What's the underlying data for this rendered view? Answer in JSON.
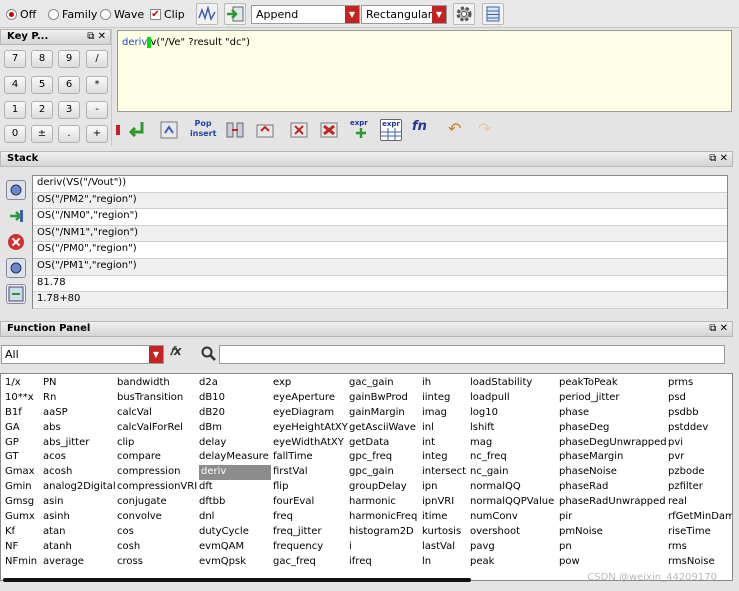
{
  "toolbar": {
    "radio_off": "Off",
    "radio_family": "Family",
    "radio_wave": "Wave",
    "check_clip": "Clip",
    "combo_mode": "Append",
    "combo_shape": "Rectangular"
  },
  "keypad": {
    "title": "Key P...",
    "keys": [
      "7",
      "8",
      "9",
      "/",
      "4",
      "5",
      "6",
      "*",
      "1",
      "2",
      "3",
      "-",
      "0",
      "±",
      ".",
      "+"
    ]
  },
  "editor": {
    "prefix": "deriv",
    "func": "v(\"/Ve\" ?result \"dc\")"
  },
  "editor_tools": {
    "pop_top": "Pop",
    "pop_bottom": "insert",
    "expr1": "expr",
    "expr2": "expr",
    "fn": "fn"
  },
  "stack": {
    "title": "Stack",
    "rows": [
      "deriv(VS(\"/Vout\"))",
      "OS(\"/PM2\",\"region\")",
      "OS(\"/NM0\",\"region\")",
      "OS(\"/NM1\",\"region\")",
      "OS(\"/PM0\",\"region\")",
      "OS(\"/PM1\",\"region\")",
      "81.78",
      "1.78+80"
    ]
  },
  "function_panel": {
    "title": "Function Panel",
    "filter": "All",
    "columns": [
      [
        "1/x",
        "10**x",
        "B1f",
        "GA",
        "GP",
        "GT",
        "Gmax",
        "Gmin",
        "Gmsg",
        "Gumx",
        "Kf",
        "NF",
        "NFmin"
      ],
      [
        "PN",
        "Rn",
        "aaSP",
        "abs",
        "abs_jitter",
        "acos",
        "acosh",
        "analog2Digital",
        "asin",
        "asinh",
        "atan",
        "atanh",
        "average"
      ],
      [
        "bandwidth",
        "busTransition",
        "calcVal",
        "calcValForRel",
        "clip",
        "compare",
        "compression",
        "compressionVRI",
        "conjugate",
        "convolve",
        "cos",
        "cosh",
        "cross"
      ],
      [
        "d2a",
        "dB10",
        "dB20",
        "dBm",
        "delay",
        "delayMeasure",
        "deriv",
        "dft",
        "dftbb",
        "dnl",
        "dutyCycle",
        "evmQAM",
        "evmQpsk"
      ],
      [
        "exp",
        "eyeAperture",
        "eyeDiagram",
        "eyeHeightAtXY",
        "eyeWidthAtXY",
        "fallTime",
        "firstVal",
        "flip",
        "fourEval",
        "freq",
        "freq_jitter",
        "frequency",
        "gac_freq"
      ],
      [
        "gac_gain",
        "gainBwProd",
        "gainMargin",
        "getAsciiWave",
        "getData",
        "gpc_freq",
        "gpc_gain",
        "groupDelay",
        "harmonic",
        "harmonicFreq",
        "histogram2D",
        "i",
        "ifreq"
      ],
      [
        "ih",
        "iinteg",
        "imag",
        "inl",
        "int",
        "integ",
        "intersect",
        "ipn",
        "ipnVRI",
        "itime",
        "kurtosis",
        "lastVal",
        "ln"
      ],
      [
        "loadStability",
        "loadpull",
        "log10",
        "lshift",
        "mag",
        "nc_freq",
        "nc_gain",
        "normalQQ",
        "normalQQPValue",
        "numConv",
        "overshoot",
        "pavg",
        "peak"
      ],
      [
        "peakToPeak",
        "period_jitter",
        "phase",
        "phaseDeg",
        "phaseDegUnwrapped",
        "phaseMargin",
        "phaseNoise",
        "phaseRad",
        "phaseRadUnwrapped",
        "pir",
        "pmNoise",
        "pn",
        "pow"
      ],
      [
        "prms",
        "psd",
        "psdbb",
        "pstddev",
        "pvi",
        "pvr",
        "pzbode",
        "pzfilter",
        "real",
        "rfGetMinDam",
        "riseTime",
        "rms",
        "rmsNoise"
      ]
    ],
    "selected": "deriv"
  },
  "watermark": "CSDN @weixin_44209170",
  "colors": {
    "accent_red": "#c62222",
    "selection_gray": "#8c8c8c",
    "editor_bg": "#ffffe8"
  }
}
